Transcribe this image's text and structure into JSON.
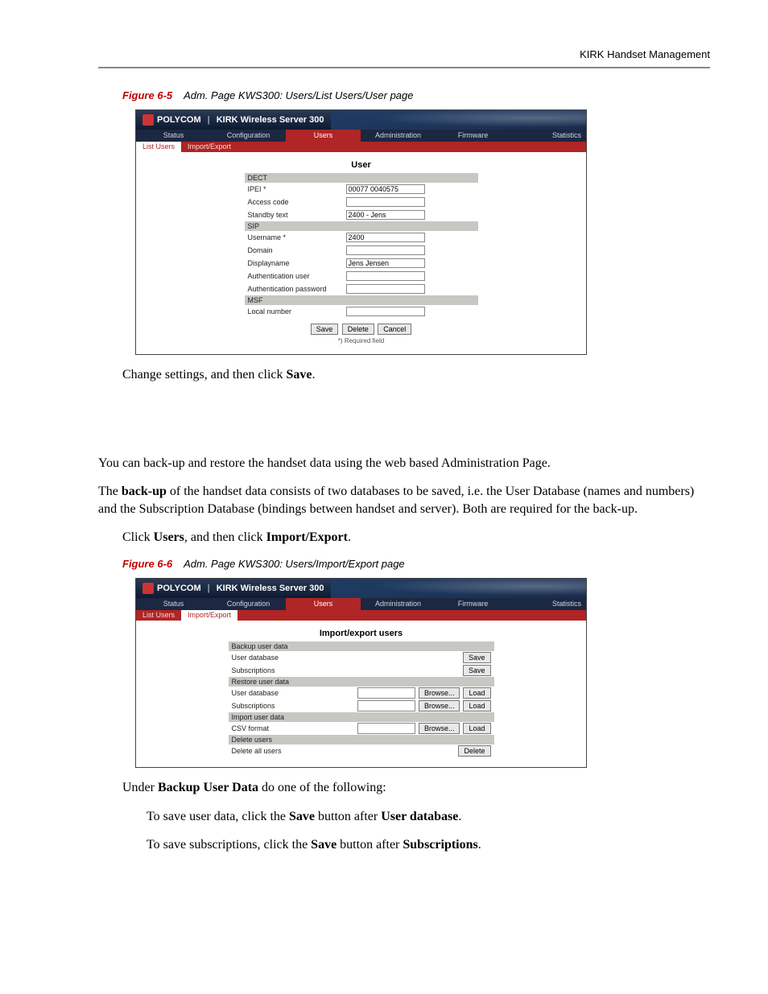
{
  "header": {
    "running_head": "KIRK Handset Management"
  },
  "figure65": {
    "caption_id": "Figure 6-5",
    "caption_text": "Adm. Page KWS300: Users/List Users/User page",
    "brand_a": "POLYCOM",
    "brand_b": "KIRK Wireless Server 300",
    "tabs_main": [
      "Status",
      "Configuration",
      "Users",
      "Administration",
      "Firmware",
      "Statistics"
    ],
    "tabs_main_active": "Users",
    "tabs_sub": [
      "List Users",
      "Import/Export"
    ],
    "tabs_sub_active": "List Users",
    "panel_title": "User",
    "sections": {
      "dect": "DECT",
      "sip": "SIP",
      "msf": "MSF"
    },
    "fields": {
      "ipei_label": "IPEI *",
      "ipei_value": "00077 0040575",
      "access_code_label": "Access code",
      "access_code_value": "",
      "standby_label": "Standby text",
      "standby_value": "2400 - Jens",
      "username_label": "Username *",
      "username_value": "2400",
      "domain_label": "Domain",
      "domain_value": "",
      "displayname_label": "Displayname",
      "displayname_value": "Jens Jensen",
      "auth_user_label": "Authentication user",
      "auth_user_value": "",
      "auth_pass_label": "Authentication password",
      "auth_pass_value": "",
      "local_number_label": "Local number",
      "local_number_value": ""
    },
    "buttons": {
      "save": "Save",
      "delete": "Delete",
      "cancel": "Cancel"
    },
    "footnote": "*) Required field"
  },
  "para_change": {
    "pre": "Change settings, and then click ",
    "bold": "Save",
    "post": "."
  },
  "para_backrestore": "You can back-up and restore the handset data using the web based Administration Page.",
  "para_backup": {
    "pre": "The ",
    "b1": "back-up",
    "post": " of the handset data consists of two databases to be saved, i.e. the User Database (names and numbers) and the Subscription Database (bindings between handset and server). Both are required for the back-up."
  },
  "para_click_ie": {
    "pre": "Click ",
    "b1": "Users",
    "mid": ", and then click ",
    "b2": "Import/Export",
    "post": "."
  },
  "figure66": {
    "caption_id": "Figure 6-6",
    "caption_text": "Adm. Page KWS300: Users/Import/Export page",
    "brand_a": "POLYCOM",
    "brand_b": "KIRK Wireless Server 300",
    "tabs_main": [
      "Status",
      "Configuration",
      "Users",
      "Administration",
      "Firmware",
      "Statistics"
    ],
    "tabs_main_active": "Users",
    "tabs_sub": [
      "List Users",
      "Import/Export"
    ],
    "tabs_sub_active": "Import/Export",
    "panel_title": "Import/export users",
    "sections": {
      "backup": "Backup user data",
      "restore": "Restore user data",
      "import": "Import user data",
      "delete": "Delete users"
    },
    "rows": {
      "user_db": "User database",
      "subs": "Subscriptions",
      "csv": "CSV format",
      "del_all": "Delete all users"
    },
    "buttons": {
      "save": "Save",
      "browse": "Browse...",
      "load": "Load",
      "delete": "Delete"
    }
  },
  "para_under": {
    "pre": "Under ",
    "b1": "Backup User Data",
    "post": " do one of the following:"
  },
  "para_save_userdb": {
    "pre": "To save user data, click the ",
    "b1": "Save",
    "mid": " button after ",
    "b2": "User database",
    "post": "."
  },
  "para_save_subs": {
    "pre": "To save subscriptions, click the ",
    "b1": "Save",
    "mid": " button after ",
    "b2": "Subscriptions",
    "post": "."
  }
}
